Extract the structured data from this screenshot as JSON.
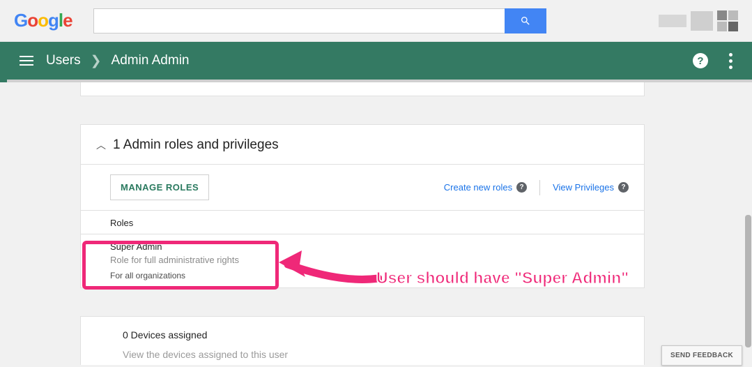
{
  "search": {
    "value": "",
    "placeholder": ""
  },
  "breadcrumb": {
    "root": "Users",
    "current": "Admin Admin"
  },
  "panel": {
    "title": "1 Admin roles and privileges",
    "manage_btn": "MANAGE ROLES",
    "create_link": "Create new roles",
    "view_link": "View Privileges",
    "roles_header": "Roles",
    "role": {
      "name": "Super Admin",
      "desc": "Role for full administrative rights",
      "scope": "For all organizations"
    }
  },
  "devices": {
    "title": "0 Devices assigned",
    "sub": "View the devices assigned to this user"
  },
  "callout": "User should have \"Super Admin\"",
  "feedback": "SEND FEEDBACK"
}
